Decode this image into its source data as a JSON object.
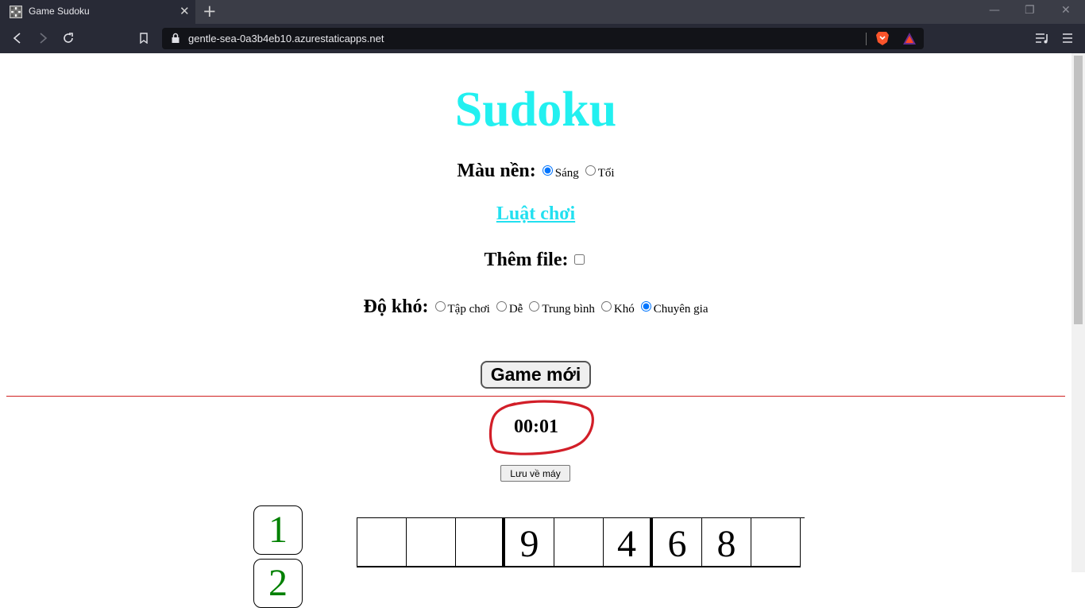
{
  "browser": {
    "tab_title": "Game Sudoku",
    "url": "gentle-sea-0a3b4eb10.azurestaticapps.net"
  },
  "page": {
    "title": "Sudoku",
    "background": {
      "label": "Màu nền:",
      "options": [
        "Sáng",
        "Tối"
      ],
      "selected": "Sáng"
    },
    "rules_link": "Luật chơi",
    "add_file_label": "Thêm file:",
    "difficulty": {
      "label": "Độ khó:",
      "options": [
        "Tập chơi",
        "Dễ",
        "Trung bình",
        "Khó",
        "Chuyên gia"
      ],
      "selected": "Chuyên gia"
    },
    "new_game_button": "Game mới",
    "timer": "00:01",
    "save_button": "Lưu về máy",
    "number_pad": [
      "1",
      "2"
    ],
    "board_first_row": [
      "",
      "",
      "",
      "9",
      "",
      "4",
      "6",
      "8",
      ""
    ],
    "colors": {
      "title": "#22f0f0",
      "number_pad": "#008000",
      "divider": "#d02020",
      "annotation_circle": "#d21e28"
    }
  }
}
